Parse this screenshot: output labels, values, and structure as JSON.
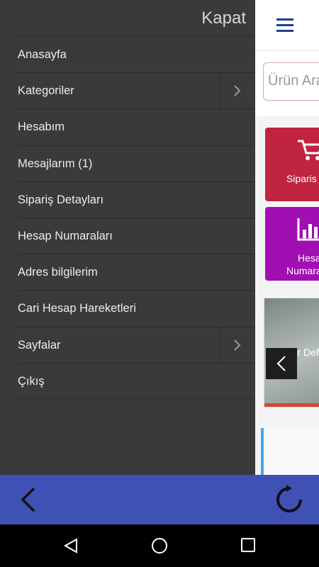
{
  "drawer": {
    "close_label": "Kapat",
    "items": [
      {
        "label": "Anasayfa",
        "has_submenu": false
      },
      {
        "label": "Kategoriler",
        "has_submenu": true
      },
      {
        "label": "Hesabım",
        "has_submenu": false
      },
      {
        "label": "Mesajlarım (1)",
        "has_submenu": false
      },
      {
        "label": "Sipariş Detayları",
        "has_submenu": false
      },
      {
        "label": "Hesap Numaraları",
        "has_submenu": false
      },
      {
        "label": "Adres bilgilerim",
        "has_submenu": false
      },
      {
        "label": "Cari Hesap Hareketleri",
        "has_submenu": false
      },
      {
        "label": "Sayfalar",
        "has_submenu": true
      },
      {
        "label": "Çıkış",
        "has_submenu": false
      }
    ]
  },
  "page": {
    "menu_icon": "hamburger-icon",
    "search_placeholder": "Ürün Ara",
    "tiles": [
      {
        "label": "Siparis",
        "icon": "cart-icon",
        "color": "#c1243f"
      },
      {
        "label_line1": "Hesa",
        "label_line2": "Numara",
        "icon": "bar-chart-icon",
        "color": "#a10fb3"
      }
    ],
    "slider_text": "Bir Def"
  },
  "appbar": {
    "color": "#3f51b5",
    "back_icon": "back-arrow-icon",
    "reload_icon": "reload-icon"
  },
  "navbar": {
    "icons": [
      "nav-back-icon",
      "nav-home-icon",
      "nav-recents-icon"
    ]
  }
}
